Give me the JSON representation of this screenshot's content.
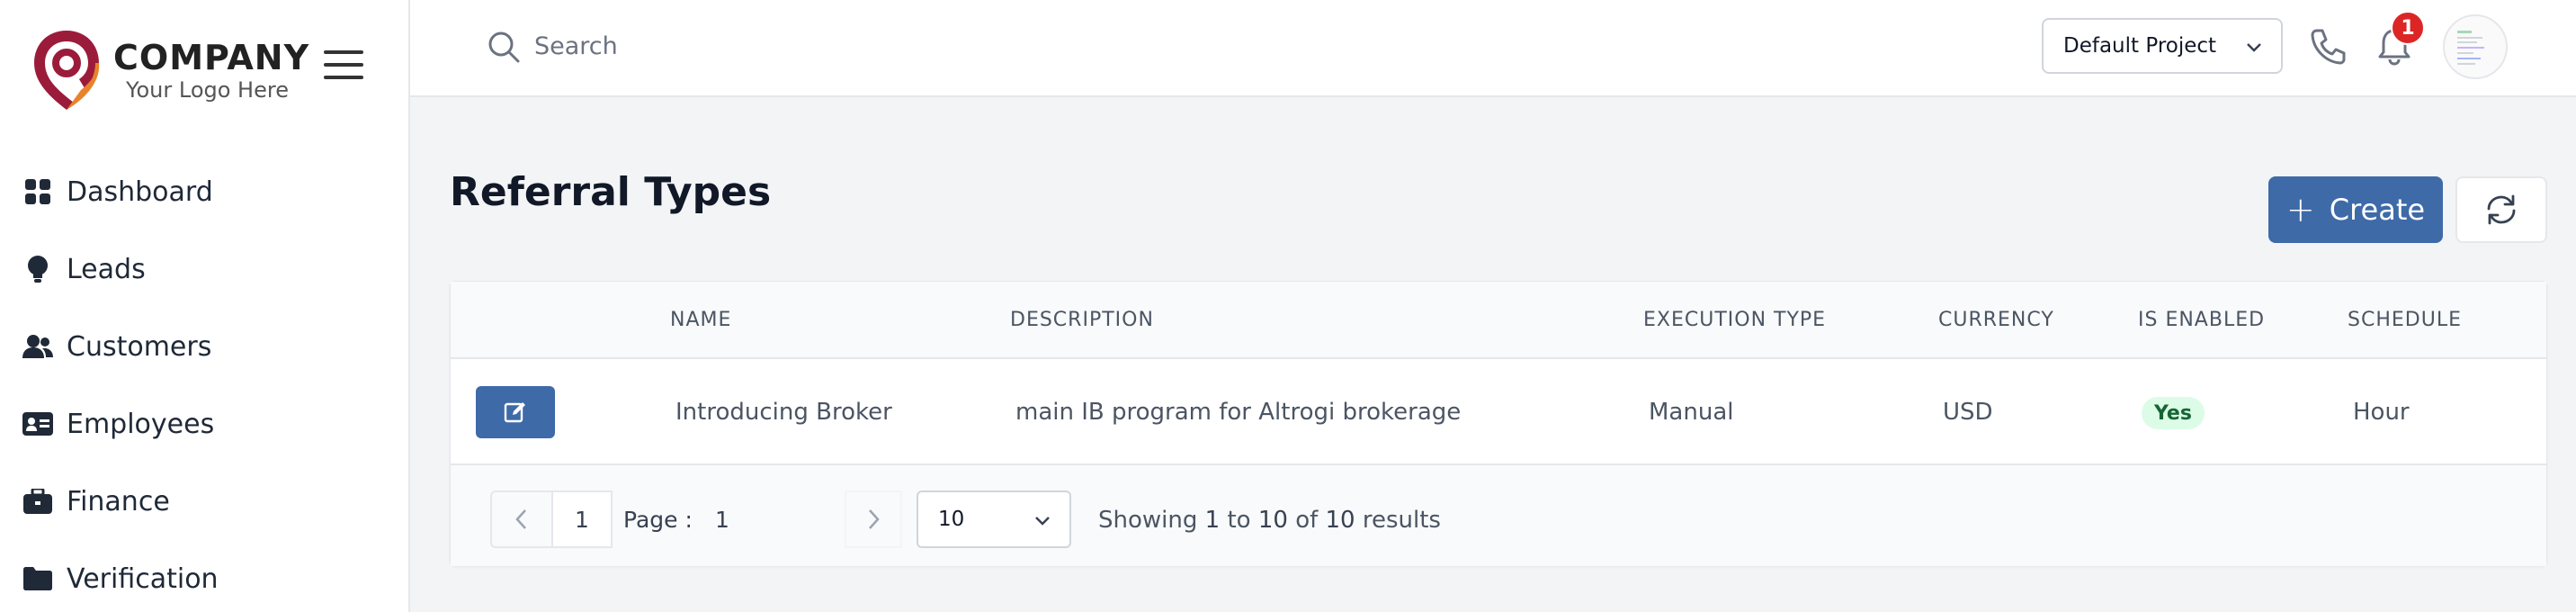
{
  "brand": {
    "company": "COMPANY",
    "tagline": "Your Logo Here",
    "colors": {
      "primary": "#3e6aa8",
      "logo_red": "#9b1c3a",
      "logo_orange": "#e8832a"
    }
  },
  "sidebar": {
    "items": [
      {
        "label": "Dashboard",
        "icon": "grid-icon"
      },
      {
        "label": "Leads",
        "icon": "lightbulb-icon"
      },
      {
        "label": "Customers",
        "icon": "users-icon"
      },
      {
        "label": "Employees",
        "icon": "id-card-icon"
      },
      {
        "label": "Finance",
        "icon": "briefcase-icon"
      },
      {
        "label": "Verification",
        "icon": "folder-icon"
      }
    ]
  },
  "header": {
    "search_placeholder": "Search",
    "project": "Default Project",
    "notification_count": "1"
  },
  "main": {
    "title": "Referral Types",
    "create_label": "Create",
    "table": {
      "columns": [
        "NAME",
        "DESCRIPTION",
        "EXECUTION TYPE",
        "CURRENCY",
        "IS ENABLED",
        "SCHEDULE"
      ],
      "rows": [
        {
          "name": "Introducing Broker",
          "description": "main IB program for Altrogi brokerage",
          "execution_type": "Manual",
          "currency": "USD",
          "is_enabled": "Yes",
          "schedule": "Hour"
        }
      ]
    },
    "pagination": {
      "page_button": "1",
      "page_label": "Page :",
      "current_page": "1",
      "page_size": "10",
      "showing_prefix": "Showing",
      "from": "1",
      "to_word": "to",
      "to": "10",
      "of_word": "of",
      "total": "10",
      "results_word": "results"
    }
  }
}
